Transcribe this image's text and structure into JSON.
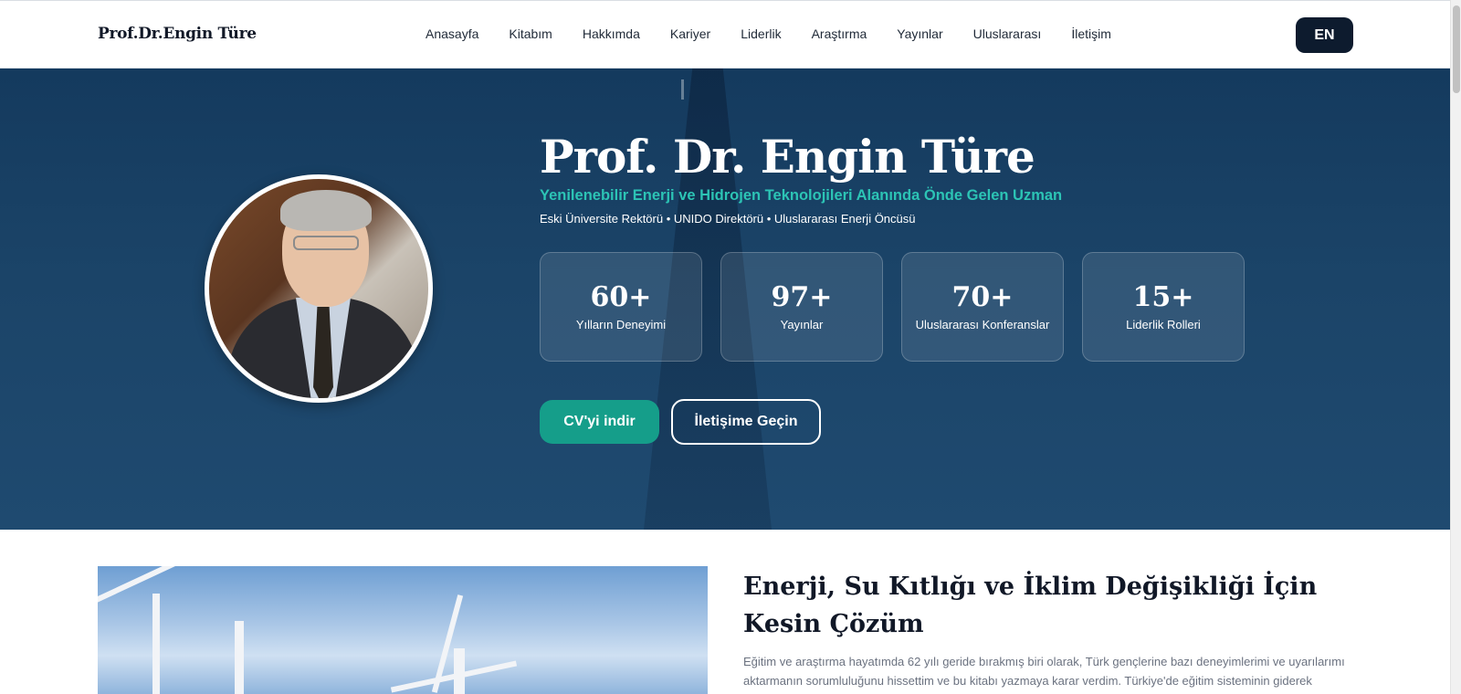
{
  "header": {
    "logo": "Prof.Dr.Engin Türe",
    "nav": [
      "Anasayfa",
      "Kitabım",
      "Hakkımda",
      "Kariyer",
      "Liderlik",
      "Araştırma",
      "Yayınlar",
      "Uluslararası",
      "İletişim"
    ],
    "lang": "EN"
  },
  "hero": {
    "name": "Prof. Dr. Engin Türe",
    "subtitle": "Yenilenebilir Enerji ve Hidrojen Teknolojileri Alanında Önde Gelen Uzman",
    "roles": "Eski Üniversite Rektörü • UNIDO Direktörü • Uluslararası Enerji Öncüsü",
    "stats": [
      {
        "value": "60+",
        "label": "Yılların Deneyimi"
      },
      {
        "value": "97+",
        "label": "Yayınlar"
      },
      {
        "value": "70+",
        "label": "Uluslararası Konferanslar"
      },
      {
        "value": "15+",
        "label": "Liderlik Rolleri"
      }
    ],
    "cv_button": "CV'yi indir",
    "contact_button": "İletişime Geçin"
  },
  "book_section": {
    "title": "Enerji, Su Kıtlığı ve İklim Değişikliği İçin Kesin Çözüm",
    "text": "Eğitim ve araştırma hayatımda 62 yılı geride bırakmış biri olarak, Türk gençlerine bazı deneyimlerimi ve uyarılarımı aktarmanın sorumluluğunu hissettim ve bu kitabı yazmaya karar verdim. Türkiye'de eğitim sisteminin giderek"
  },
  "colors": {
    "hero_bg": "#1b4468",
    "accent_teal": "#2cc4b5",
    "cv_button": "#159e8a",
    "lang_button": "#0d1b2e"
  }
}
